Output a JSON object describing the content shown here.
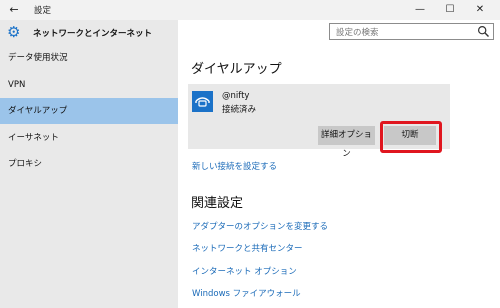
{
  "window": {
    "back_icon": "back-arrow-icon",
    "title": "設定",
    "minimize": "—",
    "maximize": "☐",
    "close": "✕"
  },
  "sidebar": {
    "header_icon": "gear-icon",
    "title": "ネットワークとインターネット",
    "items": [
      {
        "label": "データ使用状況",
        "active": false
      },
      {
        "label": "VPN",
        "active": false
      },
      {
        "label": "ダイヤルアップ",
        "active": true
      },
      {
        "label": "イーサネット",
        "active": false
      },
      {
        "label": "プロキシ",
        "active": false
      }
    ]
  },
  "search": {
    "placeholder": "設定の検索",
    "icon": "search-icon"
  },
  "main": {
    "heading": "ダイヤルアップ",
    "connection": {
      "icon": "dialup-phone-icon",
      "name": "@nifty",
      "status": "接続済み",
      "advanced_button": "詳細オプション",
      "disconnect_button": "切断"
    },
    "new_connection_link": "新しい接続を設定する",
    "related_heading": "関連設定",
    "related_links": [
      "アダプターのオプションを変更する",
      "ネットワークと共有センター",
      "インターネット オプション",
      "Windows ファイアウォール"
    ]
  },
  "colors": {
    "accent": "#1b72c8",
    "link": "#1a6ab8",
    "selected": "#9bc4ea",
    "highlight_box": "#e0161f"
  }
}
